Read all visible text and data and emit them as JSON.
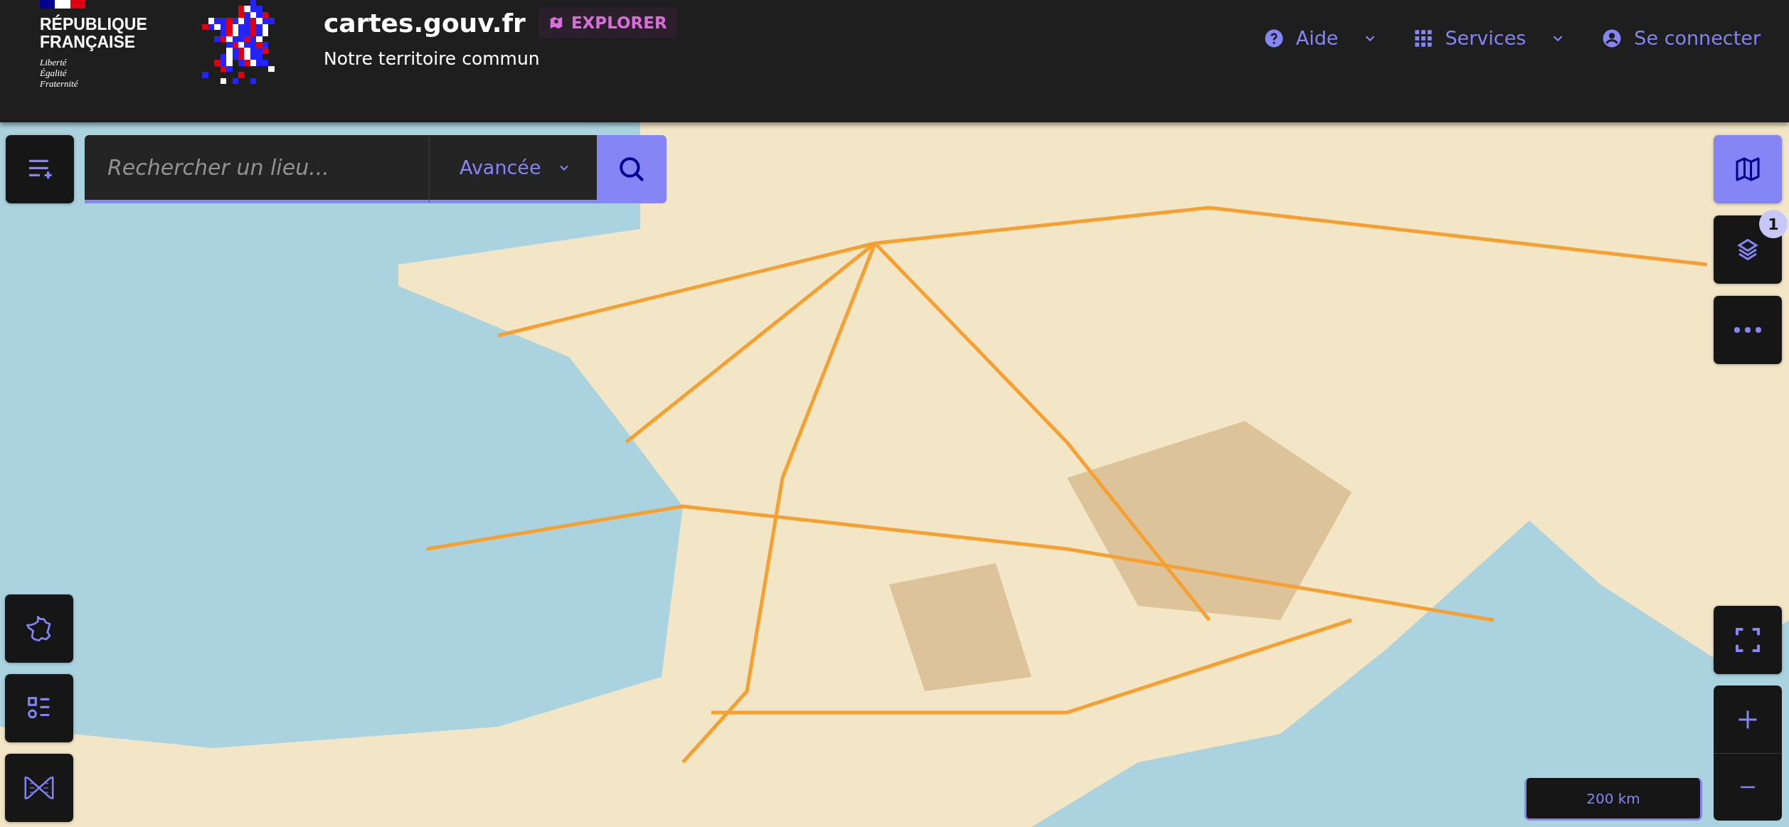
{
  "header": {
    "marianne": {
      "name_lines": [
        "RÉPUBLIQUE",
        "FRANÇAISE"
      ],
      "motto": [
        "Liberté",
        "Égalité",
        "Fraternité"
      ]
    },
    "site_title": "cartes.gouv.fr",
    "badge": "EXPLORER",
    "tagline": "Notre territoire commun",
    "nav": [
      {
        "label": "Aide",
        "kind": "help",
        "dropdown": true
      },
      {
        "label": "Services",
        "kind": "services",
        "dropdown": true
      },
      {
        "label": "Se connecter",
        "kind": "account",
        "dropdown": false
      }
    ]
  },
  "search": {
    "placeholder": "Rechercher un lieu...",
    "mode": "Avancée"
  },
  "right_controls": [
    {
      "kind": "map",
      "selected": true
    },
    {
      "kind": "layers",
      "selected": false,
      "badge": "1"
    },
    {
      "kind": "more",
      "selected": false
    }
  ],
  "left_controls": [
    {
      "kind": "territory"
    },
    {
      "kind": "legend"
    },
    {
      "kind": "streetview"
    }
  ],
  "scale": "200 km"
}
